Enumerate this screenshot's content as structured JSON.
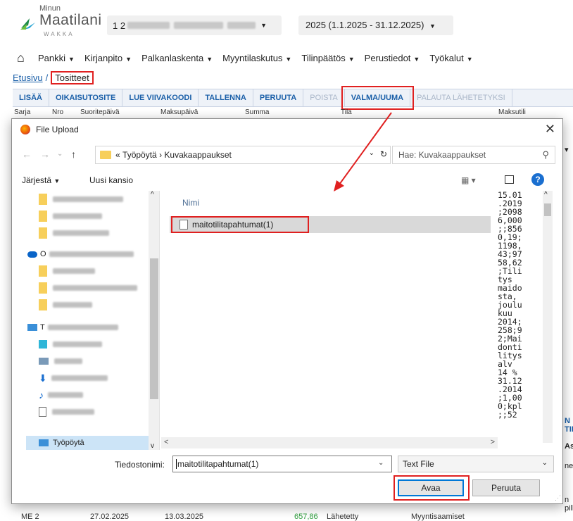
{
  "app": {
    "logo_top": "Minun",
    "logo_main": "Maatilani",
    "logo_sub": "WAKKA",
    "company_prefix": "1 2",
    "period": "2025 (1.1.2025 - 31.12.2025)"
  },
  "menu": {
    "items": [
      "Pankki",
      "Kirjanpito",
      "Palkanlaskenta",
      "Myyntilaskutus",
      "Tilinpäätös",
      "Perustiedot",
      "Työkalut"
    ]
  },
  "breadcrumb": {
    "home": "Etusivu",
    "sep": "/",
    "current": "Tositteet"
  },
  "toolbar": {
    "lisaa": "LISÄÄ",
    "oikaisutosite": "OIKAISUTOSITE",
    "lue_viivakoodi": "LUE VIIVAKOODI",
    "tallenna": "TALLENNA",
    "peruuta": "PERUUTA",
    "poista": "POISTA",
    "valma": "VALMA/UUMA",
    "palauta": "PALAUTA LÄHETETYKSI"
  },
  "grid_head": {
    "c1": "Sarja",
    "c2": "Nro",
    "c3": "Suoritepäivä",
    "c4": "Maksupäivä",
    "c5": "Summa",
    "c6": "Tila",
    "c7": "Maksutili"
  },
  "bottom_row": {
    "c1": "ME 2",
    "c2": "27.02.2025",
    "c3": "13.03.2025",
    "c4": "657,86",
    "c5": "Lähetetty",
    "c6": "Myyntisaamiset"
  },
  "right_peek": {
    "a": "N TIL",
    "b": "Asiak",
    "c": "nen",
    "d": "n pilk"
  },
  "dialog": {
    "title": "File Upload",
    "close": "✕",
    "address": {
      "prefix": "«",
      "folder1": "Työpöytä",
      "arrow": "›",
      "folder2": "Kuvakaappaukset"
    },
    "search_placeholder": "Hae: Kuvakaappaukset",
    "cmd_organize": "Järjestä",
    "cmd_new_folder": "Uusi kansio",
    "nav_partial_o": "O",
    "nav_partial_t": "T",
    "nav_desktop": "Työpöytä",
    "column_name": "Nimi",
    "file_name": "maitotilitapahtumat(1)",
    "preview_text": "15.01\n.2019\n;2098\n6,000\n;;856\n0,19;\n1198,\n43;97\n58,62\n;Tili\ntys\nmaido\nsta,\njoulu\nkuu\n2014;\n258;9\n2;Mai\ndonti\nlitys\nalv\n14 %\n31.12\n.2014\n;1,00\n0;kpl\n;;52",
    "filename_label": "Tiedostonimi:",
    "filename_value": "maitotilitapahtumat(1)",
    "file_type": "Text File",
    "open_button": "Avaa",
    "cancel_button": "Peruuta"
  },
  "colors": {
    "accent": "#1a5fa8",
    "highlight": "#e02020",
    "selection": "#d9d9d9"
  }
}
